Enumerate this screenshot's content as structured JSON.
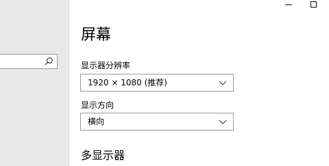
{
  "window": {
    "caption": {
      "minimize_icon": "minimize-icon",
      "maximize_icon": "maximize-icon"
    }
  },
  "sidebar": {
    "search": {
      "value": "",
      "placeholder": "",
      "icon": "search-icon"
    }
  },
  "main": {
    "title": "屏幕",
    "resolution": {
      "label": "显示器分辨率",
      "value": "1920 × 1080 (推荐)",
      "icon": "chevron-down-icon"
    },
    "orientation": {
      "label": "显示方向",
      "value": "横向",
      "icon": "chevron-down-icon"
    },
    "multi_display_title": "多显示器"
  },
  "colors": {
    "sidebar_bg": "#e9e9e9",
    "border": "#999999",
    "text": "#000000"
  }
}
